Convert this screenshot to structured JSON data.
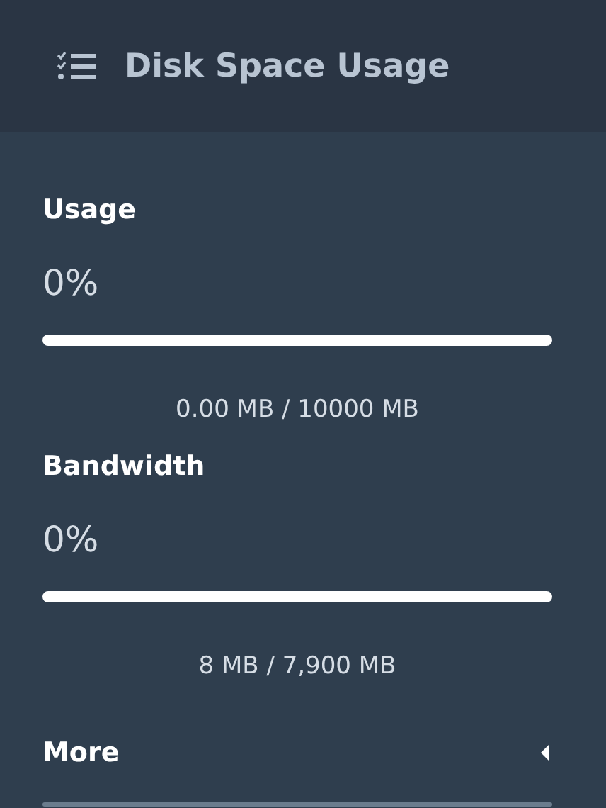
{
  "header": {
    "title": "Disk Space Usage"
  },
  "meters": [
    {
      "label": "Usage",
      "percent": "0%",
      "level": 0,
      "reading": "0.00 MB / 10000 MB"
    },
    {
      "label": "Bandwidth",
      "percent": "0%",
      "level": 0,
      "reading": "8 MB / 7,900 MB"
    }
  ],
  "more": {
    "label": "More",
    "expanded": false
  }
}
